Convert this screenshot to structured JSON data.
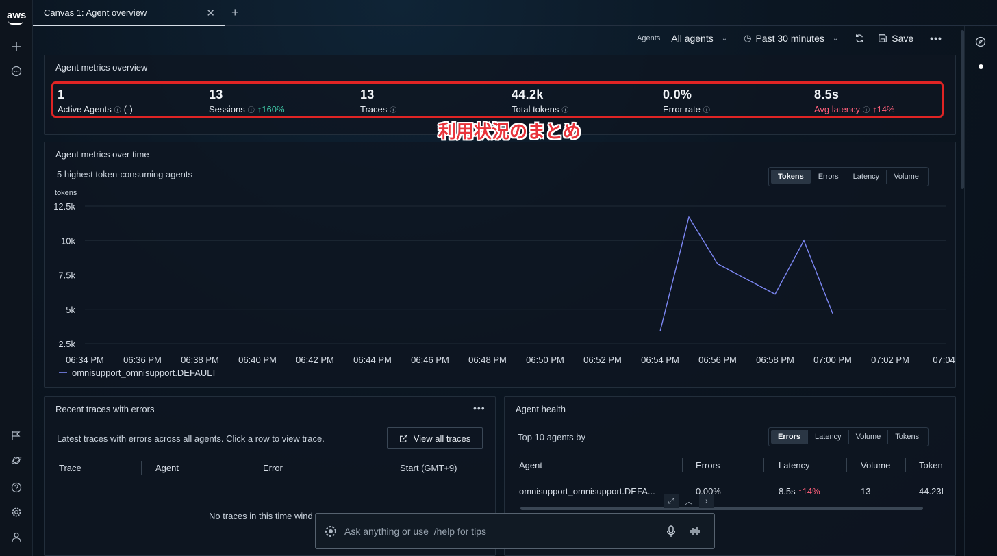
{
  "tab": {
    "title": "Canvas 1: Agent overview"
  },
  "logo": {
    "text": "aws"
  },
  "toolbar": {
    "agents_label": "Agents",
    "agents_value": "All agents",
    "time_value": "Past 30 minutes",
    "save_label": "Save"
  },
  "overview": {
    "title": "Agent metrics overview",
    "metrics": [
      {
        "value": "1",
        "label": "Active Agents",
        "delta": "(-)"
      },
      {
        "value": "13",
        "label": "Sessions",
        "delta": "↑160%"
      },
      {
        "value": "13",
        "label": "Traces",
        "delta": ""
      },
      {
        "value": "44.2k",
        "label": "Total tokens",
        "delta": ""
      },
      {
        "value": "0.0%",
        "label": "Error rate",
        "delta": ""
      },
      {
        "value": "8.5s",
        "label": "Avg latency",
        "delta": "↑14%"
      }
    ],
    "annotation": "利用状況のまとめ"
  },
  "over_time": {
    "title": "Agent metrics over time",
    "subtitle": "5 highest token-consuming agents",
    "tabs": [
      "Tokens",
      "Errors",
      "Latency",
      "Volume"
    ],
    "active_tab": "Tokens"
  },
  "chart_data": {
    "type": "line",
    "ylabel": "tokens",
    "yticks": [
      "12.5k",
      "10k",
      "7.5k",
      "5k",
      "2.5k"
    ],
    "ylim": [
      2500,
      12500
    ],
    "xticks": [
      "06:34 PM",
      "06:36 PM",
      "06:38 PM",
      "06:40 PM",
      "06:42 PM",
      "06:44 PM",
      "06:46 PM",
      "06:48 PM",
      "06:50 PM",
      "06:52 PM",
      "06:54 PM",
      "06:56 PM",
      "06:58 PM",
      "07:00 PM",
      "07:02 PM",
      "07:04..."
    ],
    "series": [
      {
        "name": "omnisupport_omnisupport.DEFAULT",
        "color": "#7b86f2",
        "x": [
          "06:54 PM",
          "06:55 PM",
          "06:56 PM",
          "06:57 PM",
          "06:58 PM",
          "06:59 PM",
          "07:00 PM"
        ],
        "values": [
          3400,
          11700,
          8300,
          7200,
          6100,
          10000,
          4700
        ]
      }
    ],
    "grid": true,
    "legend_position": "bottom-left"
  },
  "errors_panel": {
    "title": "Recent traces with errors",
    "description": "Latest traces with errors across all agents. Click a row to view trace.",
    "view_all_label": "View all traces",
    "columns": [
      "Trace",
      "Agent",
      "Error",
      "Start (GMT+9)"
    ],
    "empty_text": "No traces in this time wind"
  },
  "health_panel": {
    "title": "Agent health",
    "subtitle": "Top 10 agents by",
    "tabs": [
      "Errors",
      "Latency",
      "Volume",
      "Tokens"
    ],
    "active_tab": "Errors",
    "columns": [
      "Agent",
      "Errors",
      "Latency",
      "Volume",
      "Token"
    ],
    "rows": [
      {
        "agent": "omnisupport_omnisupport.DEFA...",
        "errors": "0.00%",
        "latency": "8.5s",
        "latency_delta": "↑14%",
        "volume": "13",
        "tokens": "44.23I"
      }
    ]
  },
  "prompt": {
    "placeholder": "Ask anything or use  /help for tips"
  }
}
